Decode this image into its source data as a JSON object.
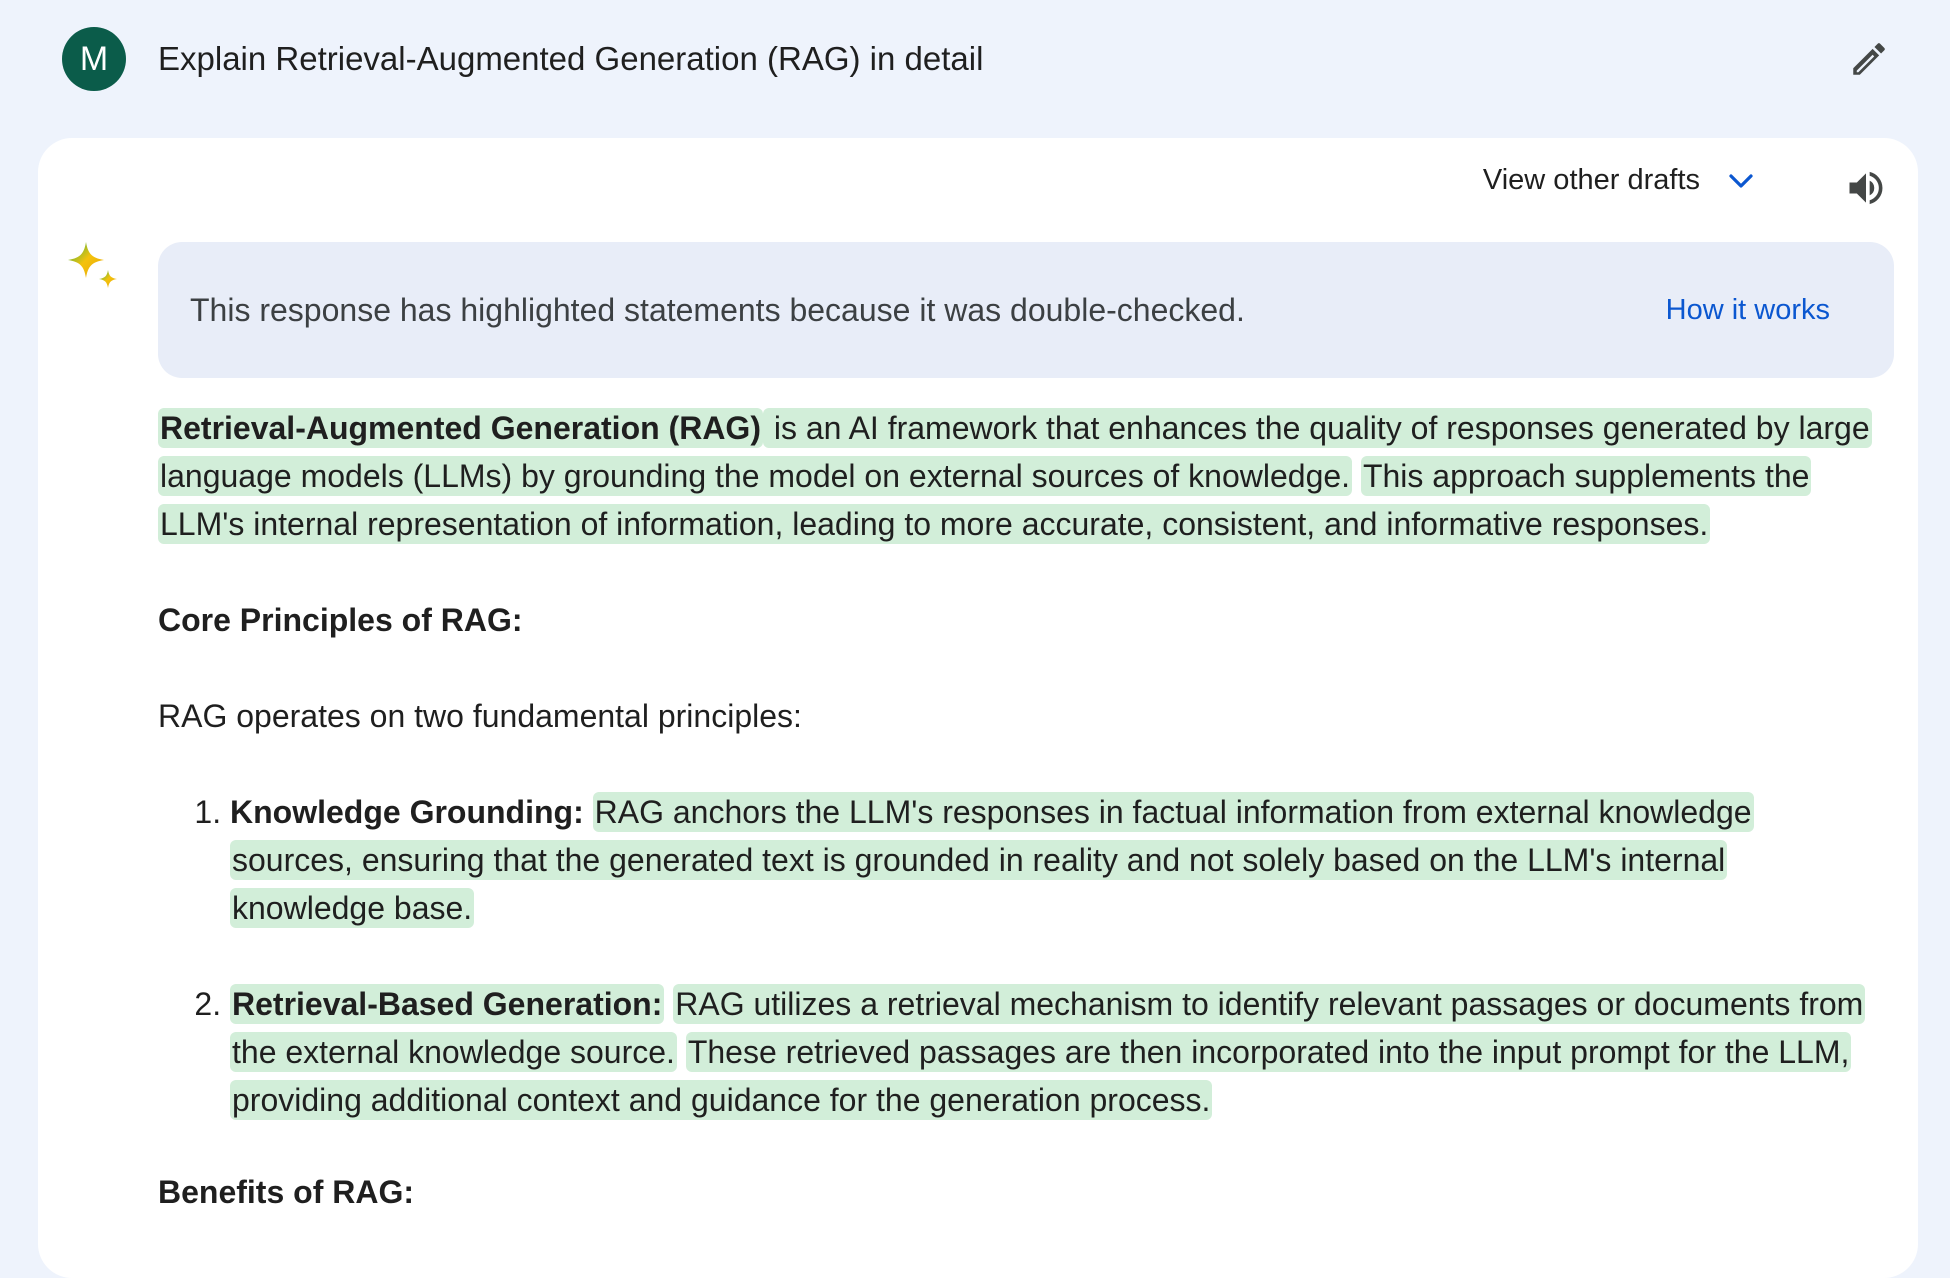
{
  "user": {
    "avatar_letter": "M",
    "query": "Explain Retrieval-Augmented Generation (RAG) in detail"
  },
  "response": {
    "drafts_label": "View other drafts",
    "notice_text": "This response has highlighted statements because it was double-checked.",
    "how_it_works": "How it works",
    "intro": {
      "term": "Retrieval-Augmented Generation (RAG)",
      "s1": " is an AI framework that enhances the quality of responses generated by large language models (LLMs) by grounding the model on external sources of knowledge.",
      "s2": "This approach supplements the LLM's internal representation of information, leading to more accurate, consistent, and informative responses."
    },
    "core_heading": "Core Principles of RAG:",
    "core_intro": "RAG operates on two fundamental principles:",
    "principles": [
      {
        "title": "Knowledge Grounding:",
        "text": "RAG anchors the LLM's responses in factual information from external knowledge sources, ensuring that the generated text is grounded in reality and not solely based on the LLM's internal knowledge base."
      },
      {
        "title": "Retrieval-Based Generation:",
        "text": "RAG utilizes a retrieval mechanism to identify relevant passages or documents from the external knowledge source.",
        "text2": "These retrieved passages are then incorporated into the input prompt for the LLM, providing additional context and guidance for the generation process."
      }
    ],
    "benefits_heading": "Benefits of RAG:"
  },
  "colors": {
    "background": "#eef3fc",
    "avatar": "#0b5c4a",
    "highlight": "#d2eed9",
    "link": "#0b57d0",
    "notice_bg": "#e8edf8"
  }
}
